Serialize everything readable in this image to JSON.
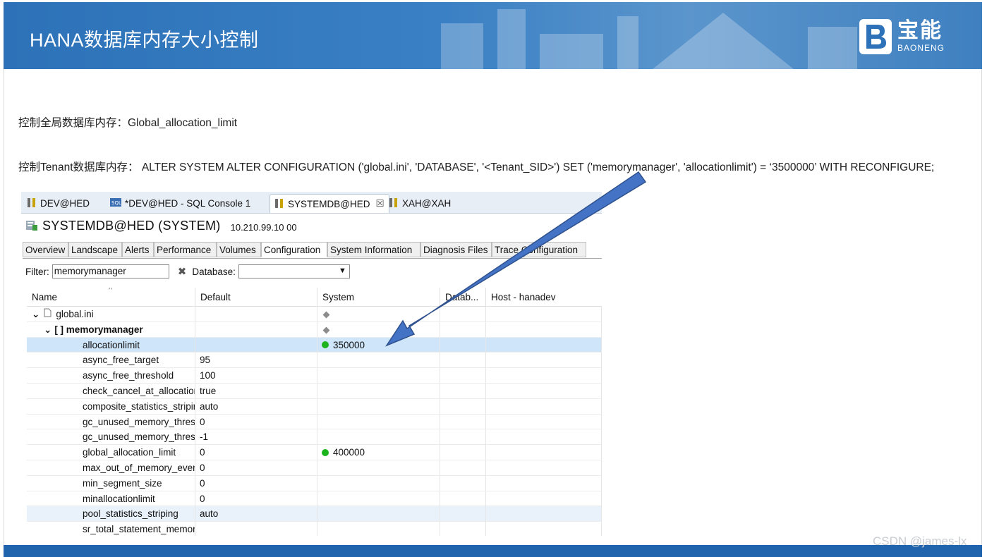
{
  "slide": {
    "title": "HANA数据库内存大小控制",
    "logo_cn": "宝能",
    "logo_en": "BAONENG",
    "line1": "控制全局数据库内存：Global_allocation_limit",
    "line2": "控制Tenant数据库内存： ALTER SYSTEM ALTER CONFIGURATION ('global.ini', 'DATABASE', '<Tenant_SID>') SET ('memorymanager', 'allocationlimit') = ‘3500000’ WITH RECONFIGURE;",
    "watermark": "CSDN @james-lx",
    "accent": "#2d72b8",
    "arrow_color": "#4472c4"
  },
  "studio": {
    "editor_tabs": [
      {
        "label": "DEV@HED",
        "icon": "system-icon"
      },
      {
        "label": "*DEV@HED - SQL Console 1",
        "icon": "sql-console-icon"
      },
      {
        "label": "SYSTEMDB@HED",
        "icon": "system-icon"
      },
      {
        "label": "XAH@XAH",
        "icon": "system-icon"
      }
    ],
    "close_glyph": "☒",
    "system_title": "SYSTEMDB@HED (SYSTEM)",
    "system_ip": "10.210.99.10 00",
    "sub_tabs": [
      "Overview",
      "Landscape",
      "Alerts",
      "Performance",
      "Volumes",
      "Configuration",
      "System Information",
      "Diagnosis Files",
      "Trace Configuration"
    ],
    "filter_label": "Filter:",
    "filter_value": "memorymanager",
    "clear_glyph": "✖",
    "database_label": "Database:",
    "columns": [
      "Name",
      "Default",
      "System",
      "Datab...",
      "Host - hanadev"
    ],
    "file_row": {
      "name": "global.ini"
    },
    "section_row": {
      "name": "[ ]  memorymanager"
    },
    "rows": [
      {
        "name": "allocationlimit",
        "default": "",
        "system": "350000"
      },
      {
        "name": "async_free_target",
        "default": "95",
        "system": ""
      },
      {
        "name": "async_free_threshold",
        "default": "100",
        "system": ""
      },
      {
        "name": "check_cancel_at_allocation",
        "default": "true",
        "system": ""
      },
      {
        "name": "composite_statistics_striping",
        "default": "auto",
        "system": ""
      },
      {
        "name": "gc_unused_memory_threshold",
        "default": "0",
        "system": ""
      },
      {
        "name": "gc_unused_memory_threshold",
        "default": "-1",
        "system": ""
      },
      {
        "name": "global_allocation_limit",
        "default": "0",
        "system": "400000"
      },
      {
        "name": "max_out_of_memory_events",
        "default": "0",
        "system": ""
      },
      {
        "name": "min_segment_size",
        "default": "0",
        "system": ""
      },
      {
        "name": "minallocationlimit",
        "default": "0",
        "system": ""
      },
      {
        "name": "pool_statistics_striping",
        "default": "auto",
        "system": ""
      },
      {
        "name": "sr_total_statement_memory",
        "default": "",
        "system": ""
      }
    ]
  }
}
